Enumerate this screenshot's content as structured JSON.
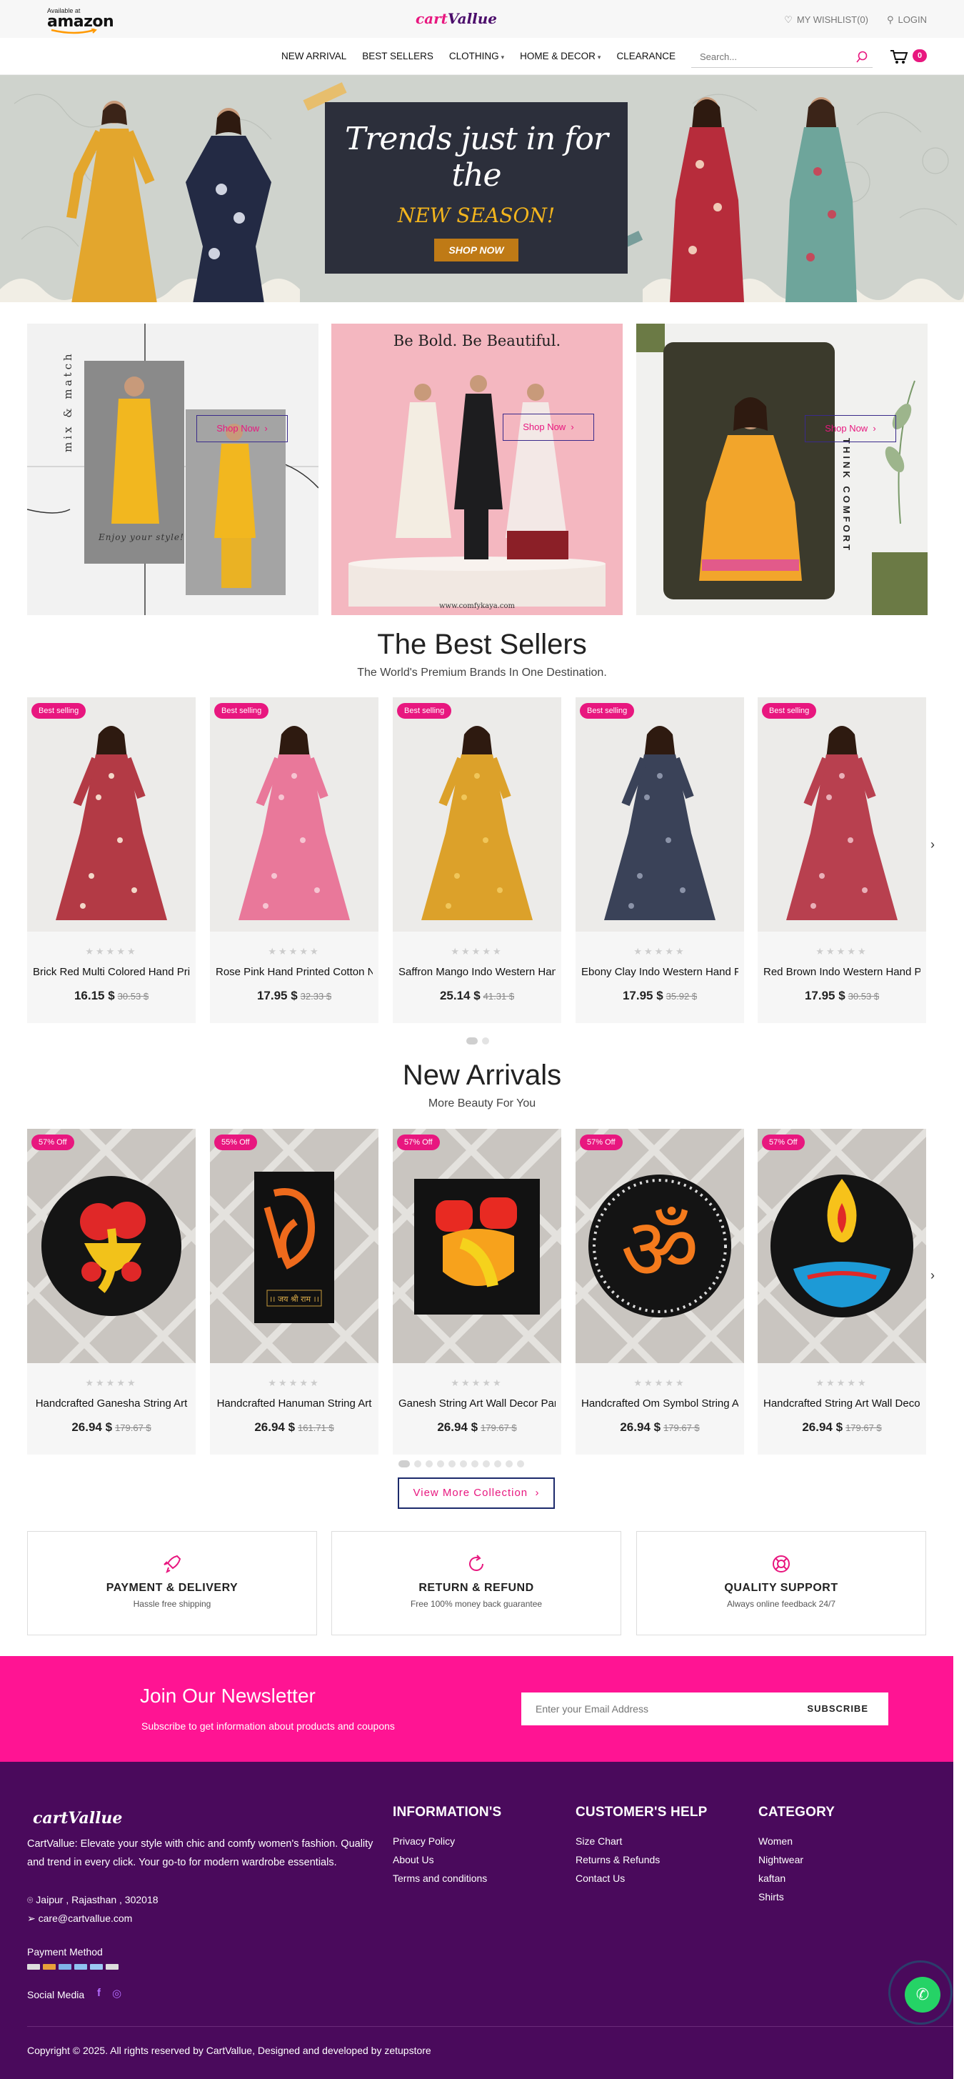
{
  "topbar": {
    "amazon_small": "Available at",
    "amazon_word": "amazon",
    "logo_part1": "cart",
    "logo_part2": "Vallue",
    "wishlist": "MY WISHLIST(0)",
    "login": "LOGIN"
  },
  "nav": {
    "items": [
      "NEW ARRIVAL",
      "BEST SELLERS",
      "CLOTHING",
      "HOME & DECOR",
      "CLEARANCE"
    ],
    "search_placeholder": "Search...",
    "cart_count": "0"
  },
  "hero": {
    "line1": "Trends just in for the",
    "line2": "NEW SEASON!",
    "cta": "SHOP NOW"
  },
  "promos": [
    {
      "side_text": "mix & match",
      "caption": "Enjoy your style!",
      "button": "Shop Now"
    },
    {
      "heading": "Be Bold. Be Beautiful.",
      "url": "www.comfykaya.com",
      "button": "Shop Now"
    },
    {
      "side_text": "THINK COMFORT",
      "button": "Shop Now"
    }
  ],
  "best_sellers": {
    "title": "The Best Sellers",
    "subtitle": "The World's Premium Brands In One Destination.",
    "products": [
      {
        "tag": "Best selling",
        "name": "Brick Red Multi Colored Hand Printed",
        "price": "16.15 $",
        "old": "30.53 $",
        "dress": "#b33a45",
        "accent": "#f3d7c8"
      },
      {
        "tag": "Best selling",
        "name": "Rose Pink Hand Printed Cotton Nightwear",
        "price": "17.95 $",
        "old": "32.33 $",
        "dress": "#e9789a",
        "accent": "#f6c5d2"
      },
      {
        "tag": "Best selling",
        "name": "Saffron Mango Indo Western Hand Printed",
        "price": "25.14 $",
        "old": "41.31 $",
        "dress": "#dca12a",
        "accent": "#f0c65a"
      },
      {
        "tag": "Best selling",
        "name": "Ebony Clay Indo Western Hand Printed",
        "price": "17.95 $",
        "old": "35.92 $",
        "dress": "#3a4258",
        "accent": "#8b93a8"
      },
      {
        "tag": "Best selling",
        "name": "Red Brown Indo Western Hand Printed",
        "price": "17.95 $",
        "old": "30.53 $",
        "dress": "#b8404f",
        "accent": "#e9b0b8"
      }
    ],
    "stars": "★★★★★"
  },
  "new_arrivals": {
    "title": "New Arrivals",
    "subtitle": "More Beauty For You",
    "products": [
      {
        "tag": "57% Off",
        "name": "Handcrafted Ganesha String Art",
        "price": "26.94 $",
        "old": "179.67 $",
        "art": "ganesha"
      },
      {
        "tag": "55% Off",
        "name": "Handcrafted Hanuman String Art",
        "price": "26.94 $",
        "old": "161.71 $",
        "art": "hanuman",
        "plate": "।। जय श्री राम ।।"
      },
      {
        "tag": "57% Off",
        "name": "Ganesh String Art Wall Decor Panel",
        "price": "26.94 $",
        "old": "179.67 $",
        "art": "ganesh2"
      },
      {
        "tag": "57% Off",
        "name": "Handcrafted Om Symbol String Art",
        "price": "26.94 $",
        "old": "179.67 $",
        "art": "om",
        "glyph": "ॐ"
      },
      {
        "tag": "57% Off",
        "name": "Handcrafted String Art Wall Decor",
        "price": "26.94 $",
        "old": "179.67 $",
        "art": "diya"
      }
    ],
    "stars": "★★★★★",
    "view_more": "View More Collection"
  },
  "features": [
    {
      "title": "PAYMENT & DELIVERY",
      "sub": "Hassle free shipping",
      "icon": "rocket-icon"
    },
    {
      "title": "RETURN & REFUND",
      "sub": "Free 100% money back guarantee",
      "icon": "refresh-icon"
    },
    {
      "title": "QUALITY SUPPORT",
      "sub": "Always online feedback 24/7",
      "icon": "lifebuoy-icon"
    }
  ],
  "newsletter": {
    "title": "Join Our Newsletter",
    "subtitle": "Subscribe to get information about products and coupons",
    "placeholder": "Enter your Email Address",
    "button": "SUBSCRIBE"
  },
  "footer": {
    "logo": "cartVallue",
    "description": "CartVallue: Elevate your style with chic and comfy women's fashion. Quality and trend in every click. Your go-to for modern wardrobe essentials.",
    "address": "Jaipur , Rajasthan , 302018",
    "email": "care@cartvallue.com",
    "payment_label": "Payment Method",
    "social_label": "Social Media",
    "columns": [
      {
        "heading": "INFORMATION'S",
        "links": [
          "Privacy Policy",
          "About Us",
          "Terms and conditions"
        ]
      },
      {
        "heading": "CUSTOMER'S HELP",
        "links": [
          "Size Chart",
          "Returns & Refunds",
          "Contact Us"
        ]
      },
      {
        "heading": "CATEGORY",
        "links": [
          "Women",
          "Nightwear",
          "kaftan",
          "Shirts"
        ]
      }
    ],
    "copyright": "Copyright © 2025. All rights reserved by CartVallue, Designed and developed by zetupstore"
  },
  "colors": {
    "brand_pink": "#e8177f",
    "brand_purple": "#4a0a5c",
    "newsletter_bg": "#ff1493"
  }
}
